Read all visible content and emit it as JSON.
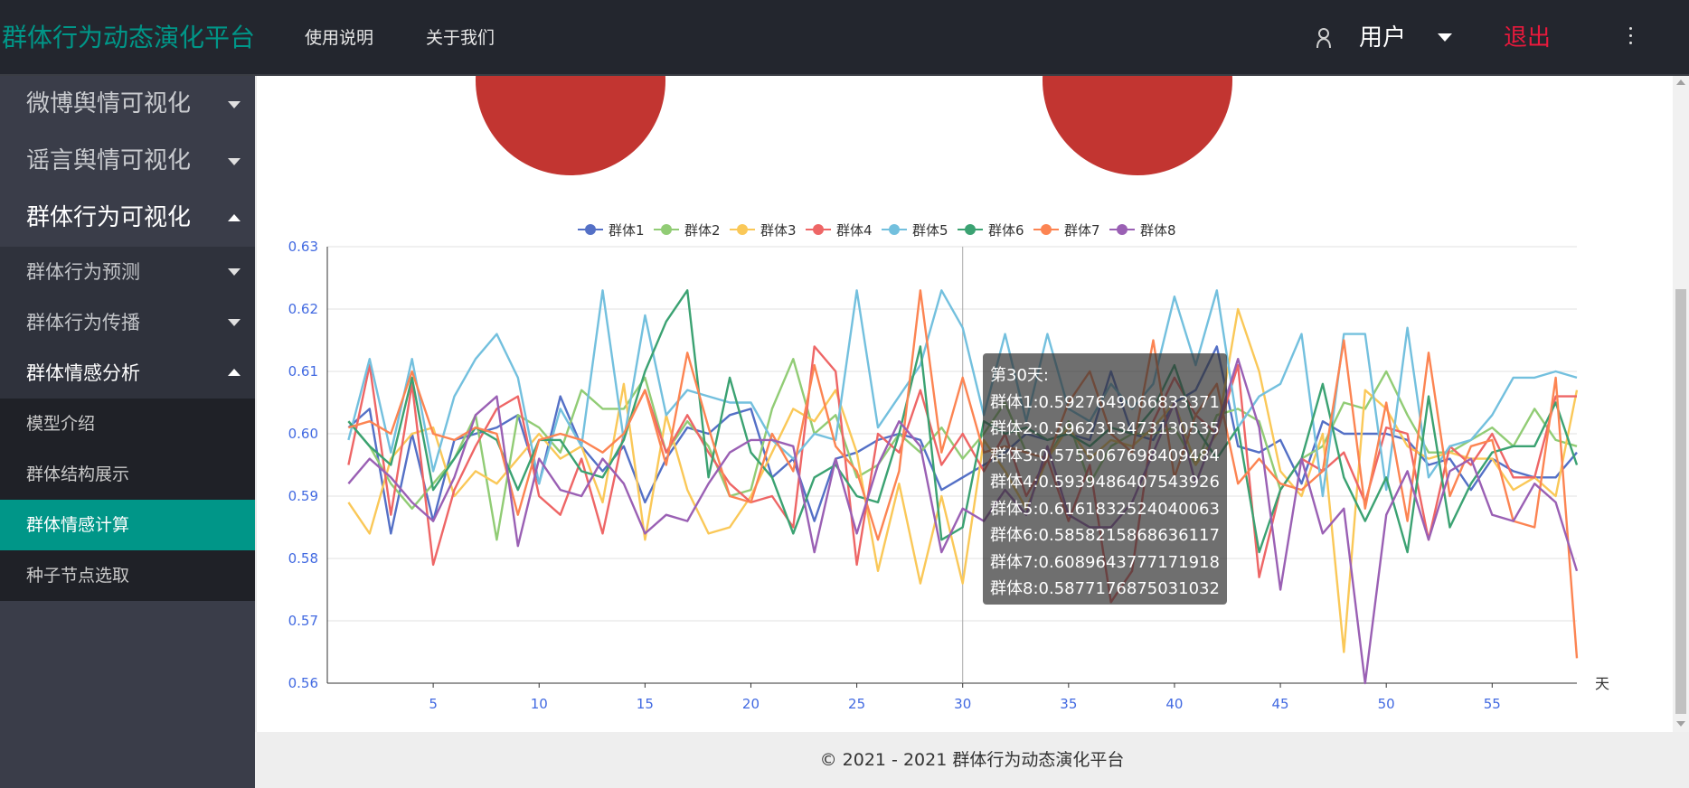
{
  "app": {
    "brand": "群体行为动态演化平台",
    "nav": [
      "使用说明",
      "关于我们"
    ],
    "user_label": "用户",
    "logout_label": "退出"
  },
  "sidebar": {
    "items": [
      {
        "label": "微博舆情可视化",
        "level": 1,
        "state": "collapsed"
      },
      {
        "label": "谣言舆情可视化",
        "level": 1,
        "state": "collapsed"
      },
      {
        "label": "群体行为可视化",
        "level": 1,
        "state": "expanded"
      },
      {
        "label": "群体行为预测",
        "level": 2,
        "state": "collapsed"
      },
      {
        "label": "群体行为传播",
        "level": 2,
        "state": "collapsed"
      },
      {
        "label": "群体情感分析",
        "level": 2,
        "state": "expanded"
      },
      {
        "label": "模型介绍",
        "level": 3
      },
      {
        "label": "群体结构展示",
        "level": 3
      },
      {
        "label": "群体情感计算",
        "level": 3,
        "active": true
      },
      {
        "label": "种子节点选取",
        "level": 3
      }
    ]
  },
  "tooltip": {
    "title": "第30天:",
    "lines": [
      "群体1:0.5927649066833371",
      "群体2:0.5962313473130535",
      "群体3:0.5755067698409484",
      "群体4:0.5939486407543926",
      "群体5:0.6161832524040063",
      "群体6:0.5858215868636117",
      "群体7:0.6089643777171918",
      "群体8:0.5877176875031032"
    ]
  },
  "footer": "© 2021 - 2021 群体行为动态演化平台",
  "chart_data": {
    "type": "line",
    "xlabel": "天",
    "ylabel": "",
    "xlim": [
      1,
      59
    ],
    "ylim": [
      0.56,
      0.63
    ],
    "x_ticks": [
      5,
      10,
      15,
      20,
      25,
      30,
      35,
      40,
      45,
      50,
      55
    ],
    "y_ticks": [
      0.56,
      0.57,
      0.58,
      0.59,
      0.6,
      0.61,
      0.62,
      0.63
    ],
    "legend_position": "top-center",
    "hover_x": 30,
    "x": [
      1,
      2,
      3,
      4,
      5,
      6,
      7,
      8,
      9,
      10,
      11,
      12,
      13,
      14,
      15,
      16,
      17,
      18,
      19,
      20,
      21,
      22,
      23,
      24,
      25,
      26,
      27,
      28,
      29,
      30,
      31,
      32,
      33,
      34,
      35,
      36,
      37,
      38,
      39,
      40,
      41,
      42,
      43,
      44,
      45,
      46,
      47,
      48,
      49,
      50,
      51,
      52,
      53,
      54,
      55,
      56,
      57,
      58,
      59
    ],
    "series": [
      {
        "name": "群体1",
        "color": "#5470c6",
        "values": [
          0.601,
          0.604,
          0.584,
          0.6,
          0.586,
          0.599,
          0.6,
          0.601,
          0.603,
          0.592,
          0.606,
          0.598,
          0.594,
          0.598,
          0.589,
          0.596,
          0.601,
          0.6,
          0.603,
          0.604,
          0.593,
          0.596,
          0.586,
          0.596,
          0.597,
          0.599,
          0.6,
          0.599,
          0.591,
          0.593,
          0.595,
          0.597,
          0.6,
          0.599,
          0.6,
          0.599,
          0.61,
          0.6,
          0.599,
          0.605,
          0.607,
          0.614,
          0.598,
          0.597,
          0.599,
          0.592,
          0.602,
          0.6,
          0.6,
          0.6,
          0.599,
          0.595,
          0.596,
          0.591,
          0.596,
          0.594,
          0.593,
          0.593,
          0.597
        ]
      },
      {
        "name": "群体2",
        "color": "#91cc75",
        "values": [
          0.602,
          0.598,
          0.592,
          0.588,
          0.592,
          0.596,
          0.603,
          0.583,
          0.603,
          0.601,
          0.597,
          0.607,
          0.604,
          0.604,
          0.609,
          0.597,
          0.602,
          0.598,
          0.59,
          0.591,
          0.604,
          0.612,
          0.6,
          0.603,
          0.593,
          0.595,
          0.6,
          0.597,
          0.601,
          0.596,
          0.6,
          0.605,
          0.597,
          0.596,
          0.602,
          0.592,
          0.598,
          0.6,
          0.6,
          0.601,
          0.595,
          0.603,
          0.604,
          0.602,
          0.591,
          0.596,
          0.598,
          0.605,
          0.604,
          0.61,
          0.603,
          0.597,
          0.597,
          0.599,
          0.601,
          0.598,
          0.604,
          0.599,
          0.598
        ]
      },
      {
        "name": "群体3",
        "color": "#fac858",
        "values": [
          0.589,
          0.584,
          0.596,
          0.6,
          0.601,
          0.59,
          0.594,
          0.592,
          0.596,
          0.6,
          0.596,
          0.598,
          0.589,
          0.608,
          0.583,
          0.603,
          0.591,
          0.584,
          0.585,
          0.59,
          0.597,
          0.604,
          0.602,
          0.607,
          0.597,
          0.578,
          0.592,
          0.576,
          0.59,
          0.576,
          0.599,
          0.594,
          0.588,
          0.596,
          0.601,
          0.596,
          0.599,
          0.598,
          0.601,
          0.605,
          0.595,
          0.6,
          0.62,
          0.61,
          0.594,
          0.59,
          0.6,
          0.565,
          0.607,
          0.604,
          0.598,
          0.596,
          0.597,
          0.596,
          0.596,
          0.591,
          0.593,
          0.59,
          0.607
        ]
      },
      {
        "name": "群体4",
        "color": "#ee6666",
        "values": [
          0.595,
          0.611,
          0.587,
          0.608,
          0.579,
          0.591,
          0.598,
          0.604,
          0.606,
          0.59,
          0.587,
          0.596,
          0.584,
          0.6,
          0.607,
          0.597,
          0.603,
          0.597,
          0.592,
          0.589,
          0.59,
          0.585,
          0.614,
          0.61,
          0.579,
          0.6,
          0.597,
          0.607,
          0.595,
          0.6,
          0.594,
          0.6,
          0.59,
          0.596,
          0.586,
          0.595,
          0.573,
          0.578,
          0.602,
          0.609,
          0.603,
          0.6,
          0.611,
          0.577,
          0.591,
          0.596,
          0.594,
          0.597,
          0.589,
          0.601,
          0.6,
          0.583,
          0.598,
          0.595,
          0.6,
          0.593,
          0.593,
          0.606,
          0.606
        ]
      },
      {
        "name": "群体5",
        "color": "#73c0de",
        "values": [
          0.599,
          0.612,
          0.597,
          0.612,
          0.594,
          0.606,
          0.612,
          0.616,
          0.609,
          0.592,
          0.604,
          0.598,
          0.623,
          0.599,
          0.619,
          0.603,
          0.607,
          0.606,
          0.605,
          0.605,
          0.599,
          0.596,
          0.6,
          0.599,
          0.623,
          0.601,
          0.606,
          0.611,
          0.623,
          0.617,
          0.603,
          0.616,
          0.602,
          0.616,
          0.604,
          0.602,
          0.608,
          0.604,
          0.608,
          0.622,
          0.611,
          0.623,
          0.601,
          0.606,
          0.608,
          0.616,
          0.59,
          0.616,
          0.616,
          0.591,
          0.617,
          0.593,
          0.598,
          0.599,
          0.603,
          0.609,
          0.609,
          0.61,
          0.609
        ]
      },
      {
        "name": "群体6",
        "color": "#3ba272",
        "values": [
          0.602,
          0.598,
          0.595,
          0.609,
          0.591,
          0.596,
          0.601,
          0.599,
          0.591,
          0.599,
          0.599,
          0.594,
          0.593,
          0.599,
          0.61,
          0.618,
          0.623,
          0.593,
          0.609,
          0.597,
          0.593,
          0.584,
          0.593,
          0.595,
          0.59,
          0.589,
          0.6,
          0.614,
          0.583,
          0.585,
          0.602,
          0.6,
          0.601,
          0.599,
          0.6,
          0.598,
          0.601,
          0.6,
          0.604,
          0.611,
          0.601,
          0.596,
          0.601,
          0.581,
          0.591,
          0.596,
          0.608,
          0.593,
          0.586,
          0.593,
          0.581,
          0.606,
          0.585,
          0.592,
          0.597,
          0.598,
          0.598,
          0.605,
          0.595
        ]
      },
      {
        "name": "群体7",
        "color": "#fc8452",
        "values": [
          0.601,
          0.602,
          0.6,
          0.61,
          0.6,
          0.599,
          0.601,
          0.6,
          0.587,
          0.599,
          0.6,
          0.599,
          0.597,
          0.6,
          0.607,
          0.595,
          0.613,
          0.601,
          0.59,
          0.589,
          0.6,
          0.594,
          0.611,
          0.598,
          0.594,
          0.583,
          0.594,
          0.623,
          0.597,
          0.609,
          0.597,
          0.598,
          0.597,
          0.596,
          0.605,
          0.61,
          0.6,
          0.597,
          0.615,
          0.593,
          0.603,
          0.608,
          0.592,
          0.596,
          0.592,
          0.591,
          0.594,
          0.615,
          0.588,
          0.605,
          0.586,
          0.613,
          0.59,
          0.598,
          0.599,
          0.586,
          0.585,
          0.609,
          0.564
        ]
      },
      {
        "name": "群体8",
        "color": "#9a60b4",
        "values": [
          0.592,
          0.596,
          0.593,
          0.589,
          0.586,
          0.593,
          0.603,
          0.606,
          0.582,
          0.596,
          0.591,
          0.59,
          0.596,
          0.592,
          0.584,
          0.587,
          0.586,
          0.592,
          0.597,
          0.599,
          0.599,
          0.598,
          0.581,
          0.596,
          0.584,
          0.595,
          0.602,
          0.598,
          0.581,
          0.588,
          0.586,
          0.591,
          0.587,
          0.598,
          0.587,
          0.585,
          0.585,
          0.589,
          0.597,
          0.605,
          0.592,
          0.601,
          0.612,
          0.601,
          0.575,
          0.596,
          0.584,
          0.588,
          0.56,
          0.587,
          0.594,
          0.583,
          0.594,
          0.596,
          0.587,
          0.586,
          0.592,
          0.589,
          0.578
        ]
      }
    ]
  }
}
